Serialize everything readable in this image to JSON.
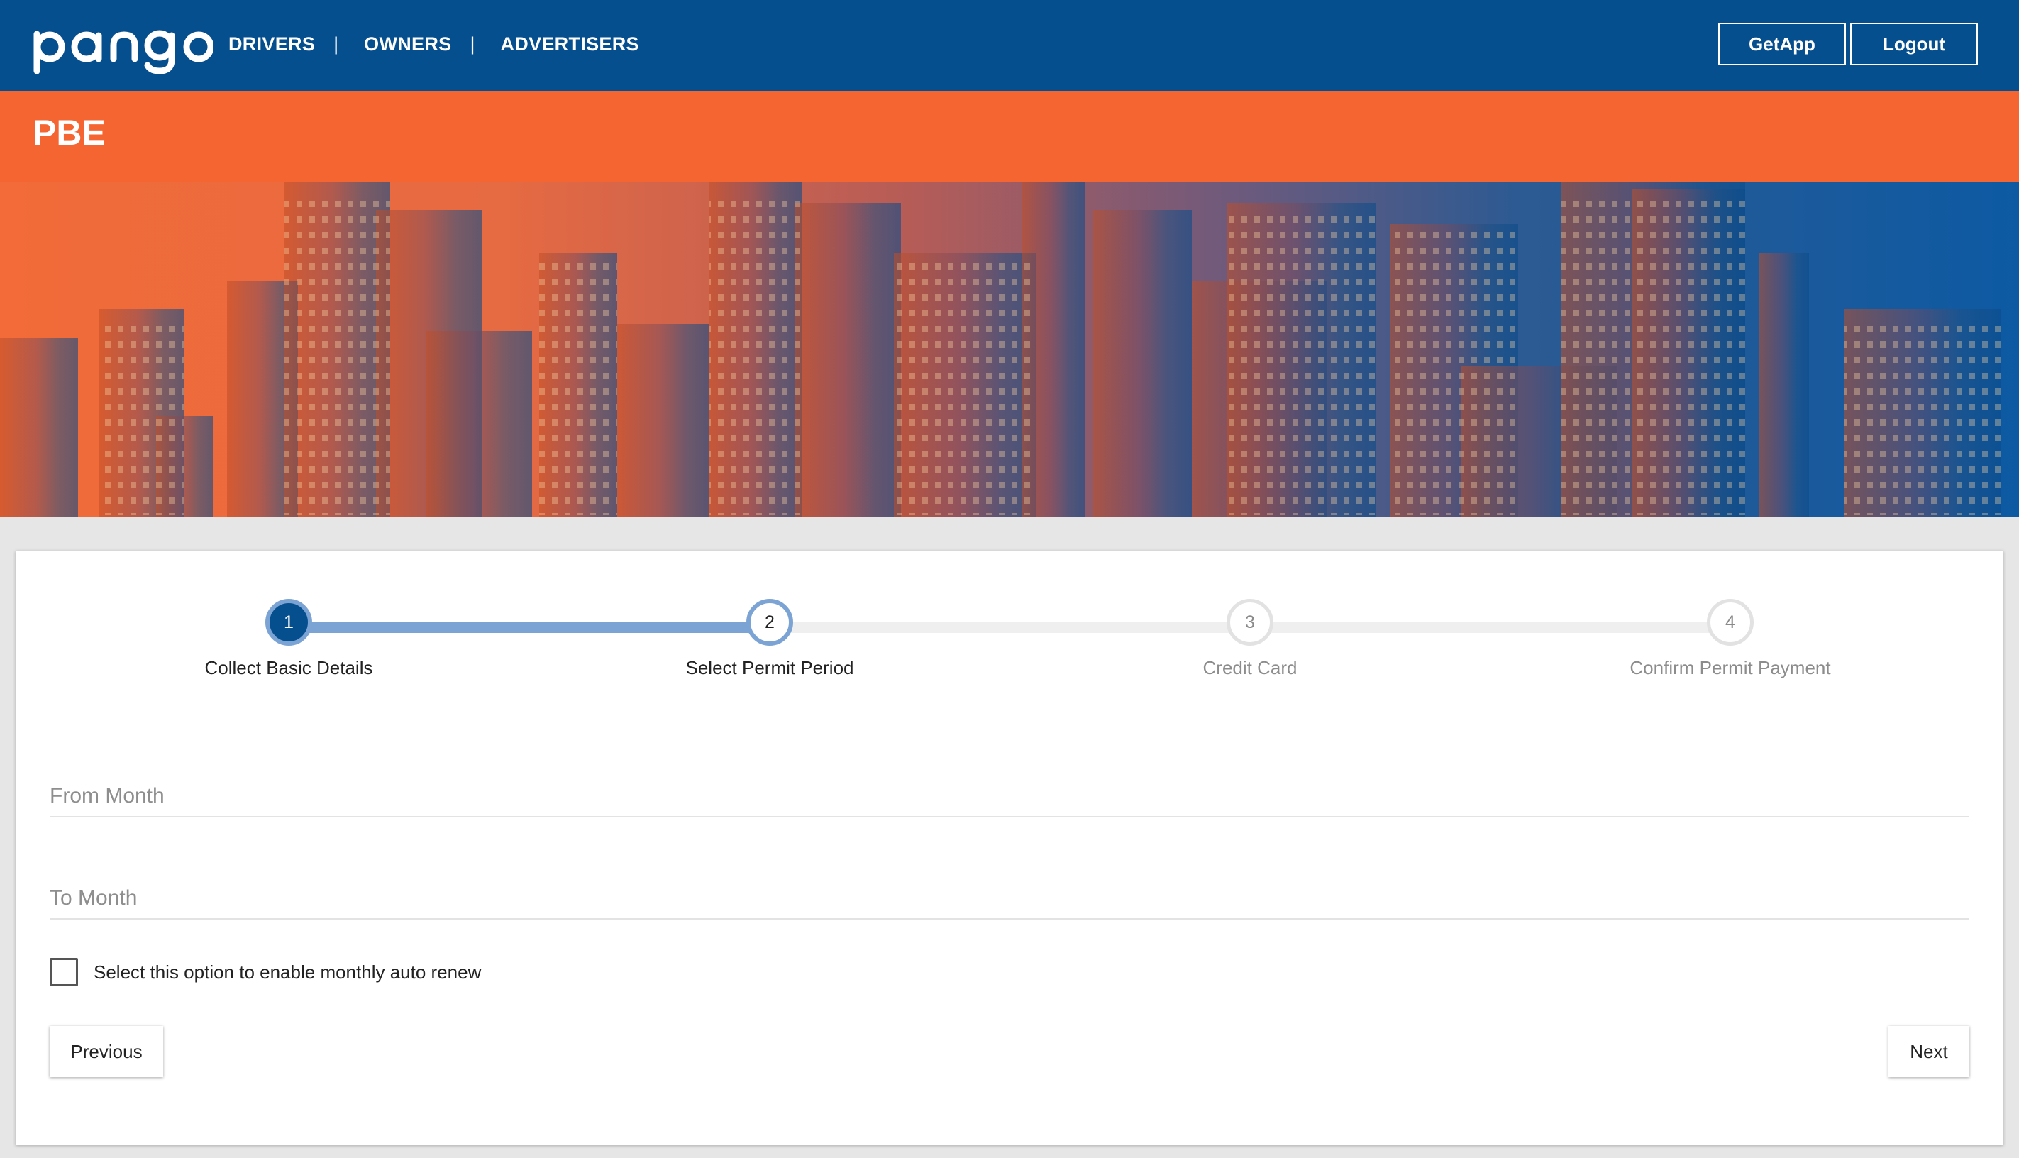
{
  "header": {
    "logo_text": "pango",
    "nav": [
      {
        "label": "DRIVERS"
      },
      {
        "label": "OWNERS"
      },
      {
        "label": "ADVERTISERS"
      }
    ],
    "nav_separator": "|",
    "getapp_label": "GetApp",
    "logout_label": "Logout"
  },
  "page": {
    "title": "PBE"
  },
  "stepper": {
    "steps": [
      {
        "number": "1",
        "label": "Collect Basic Details",
        "state": "completed"
      },
      {
        "number": "2",
        "label": "Select Permit Period",
        "state": "active"
      },
      {
        "number": "3",
        "label": "Credit Card",
        "state": "pending"
      },
      {
        "number": "4",
        "label": "Confirm Permit Payment",
        "state": "pending"
      }
    ]
  },
  "form": {
    "from_month": {
      "placeholder": "From Month",
      "value": ""
    },
    "to_month": {
      "placeholder": "To Month",
      "value": ""
    },
    "auto_renew": {
      "label": "Select this option to enable monthly auto renew",
      "checked": false
    },
    "previous_label": "Previous",
    "next_label": "Next"
  },
  "colors": {
    "primary_blue": "#064f8e",
    "accent_orange": "#f56532",
    "stepper_fill": "#7ba4d4"
  }
}
